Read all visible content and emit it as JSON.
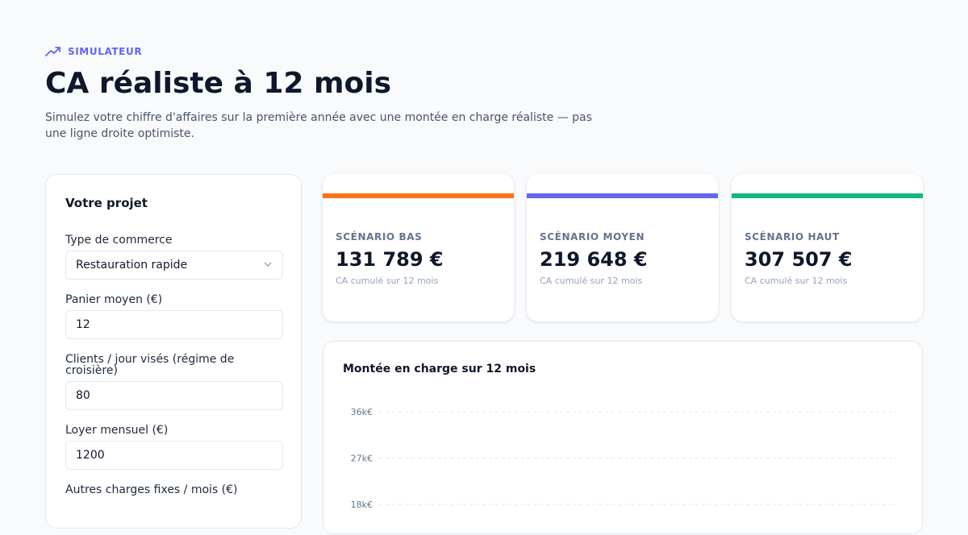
{
  "header": {
    "eyebrow": "SIMULATEUR",
    "title": "CA réaliste à 12 mois",
    "subtitle": "Simulez votre chiffre d'affaires sur la première année avec une montée en charge réaliste — pas une ligne droite optimiste."
  },
  "form": {
    "title": "Votre projet",
    "commerce_label": "Type de commerce",
    "commerce_value": "Restauration rapide",
    "panier_label": "Panier moyen (€)",
    "panier_value": "12",
    "clients_label": "Clients / jour visés (régime de croisière)",
    "clients_value": "80",
    "loyer_label": "Loyer mensuel (€)",
    "loyer_value": "1200",
    "charges_label": "Autres charges fixes / mois (€)"
  },
  "scenarios": [
    {
      "label": "SCÉNARIO BAS",
      "value": "131 789 €",
      "sub": "CA cumulé sur 12 mois",
      "color": "#f97316"
    },
    {
      "label": "SCÉNARIO MOYEN",
      "value": "219 648 €",
      "sub": "CA cumulé sur 12 mois",
      "color": "#6366f1"
    },
    {
      "label": "SCÉNARIO HAUT",
      "value": "307 507 €",
      "sub": "CA cumulé sur 12 mois",
      "color": "#10b981"
    }
  ],
  "chart_data": {
    "type": "line",
    "title": "Montée en charge sur 12 mois",
    "y_ticks": [
      "36k€",
      "27k€",
      "18k€"
    ],
    "y_tick_values": [
      36000,
      27000,
      18000
    ],
    "grid": true
  }
}
